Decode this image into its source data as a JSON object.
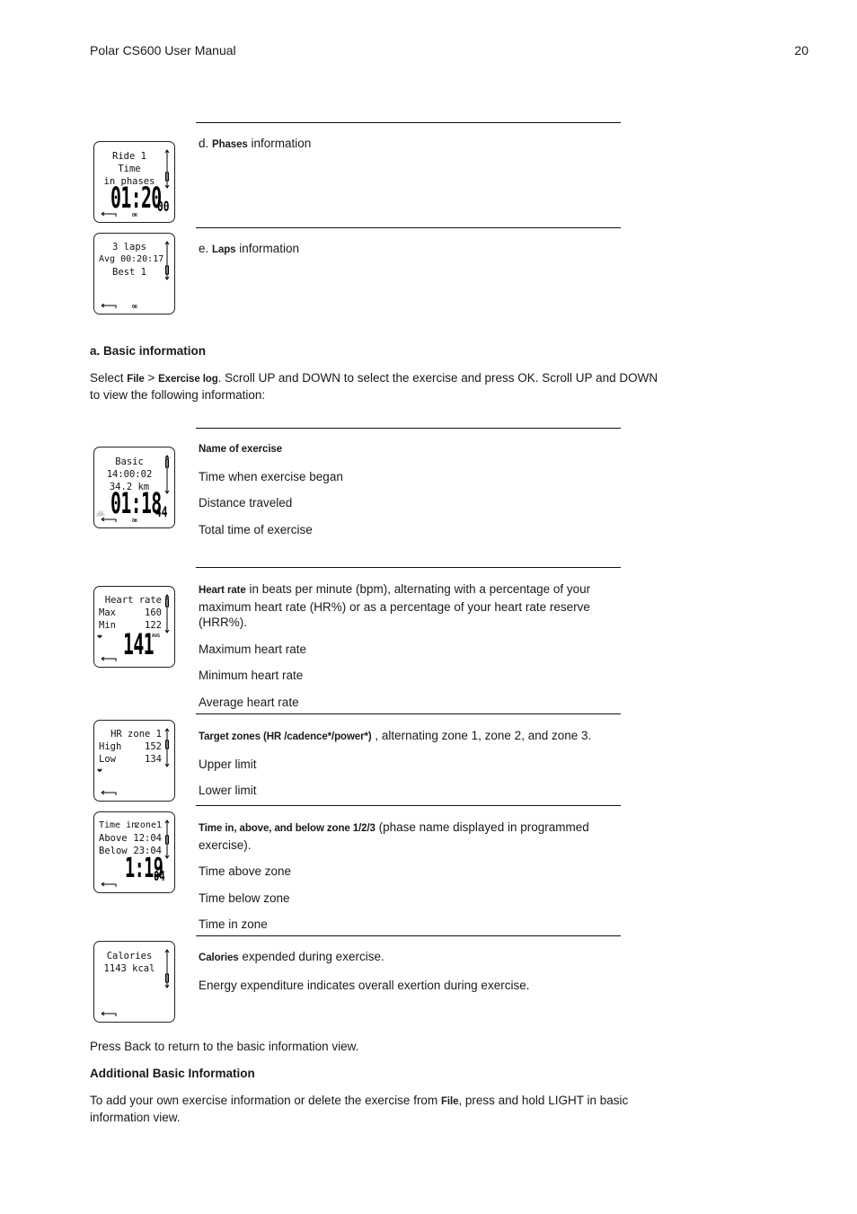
{
  "header": {
    "title": "Polar CS600 User Manual",
    "page_number": "20"
  },
  "sections": {
    "phases": {
      "prefix": "d. ",
      "bold": "Phases",
      "rest": " information"
    },
    "laps": {
      "prefix": "e. ",
      "bold": "Laps",
      "rest": " information"
    },
    "basic_heading": "a. Basic information",
    "basic_intro": {
      "t1": "Select ",
      "b1": "File",
      "t2": " > ",
      "b2": "Exercise log",
      "t3": ". Scroll UP and DOWN to select the exercise and press OK. Scroll UP and DOWN to view the following information:"
    },
    "basic_items": {
      "name": "Name of exercise",
      "items": [
        "Time when exercise began",
        "Distance traveled",
        "Total time of exercise"
      ]
    },
    "heart_rate": {
      "bold": "Heart rate",
      "rest": " in beats per minute (bpm), alternating with a percentage of your maximum heart rate (HR%) or as a percentage of your heart rate reserve (HRR%).",
      "items": [
        "Maximum heart rate",
        "Minimum heart rate",
        "Average heart rate"
      ]
    },
    "target_zones": {
      "bold": "Target zones (HR /cadence*/power*)",
      "rest": " , alternating zone 1, zone 2, and zone 3.",
      "items": [
        "Upper limit",
        "Lower limit"
      ]
    },
    "time_in_zone": {
      "bold": "Time in, above, and below zone 1/2/3",
      "rest": " (phase name displayed in programmed exercise).",
      "items": [
        "Time above zone",
        "Time below zone",
        "Time in zone"
      ]
    },
    "calories": {
      "bold": "Calories",
      "rest": " expended during exercise.",
      "items": [
        "Energy expenditure indicates overall exertion during exercise."
      ]
    },
    "press_back": "Press Back to return to the basic information view.",
    "additional_heading": "Additional Basic Information",
    "additional": {
      "t1": "To add your own exercise information or delete the exercise from ",
      "b1": "File",
      "t2": ", press and hold LIGHT in basic information view."
    }
  },
  "watch_screens": {
    "phases": {
      "lines": [
        "Ride 1",
        "Time",
        "in phases"
      ],
      "big": "01:20",
      "small": "00",
      "ok": "OK"
    },
    "laps": {
      "lines": [
        "3 laps",
        "Avg 00:20:17",
        "Best 1"
      ],
      "ok": "OK"
    },
    "basic": {
      "lines": [
        "Basic",
        "14:00:02",
        "34.2 km"
      ],
      "big": "01:18",
      "small": "44",
      "ok": "OK"
    },
    "heart_rate": {
      "title": "Heart rate",
      "rows": [
        [
          "Max",
          "160"
        ],
        [
          "Min",
          "122"
        ]
      ],
      "big": "141",
      "tag": "AVG"
    },
    "hr_zone": {
      "title": "HR zone 1",
      "rows": [
        [
          "High",
          "152"
        ],
        [
          "Low",
          "134"
        ]
      ]
    },
    "time_in_zone": {
      "rows": [
        [
          "Time in",
          "zone1"
        ],
        [
          "Above",
          "12:04"
        ],
        [
          "Below",
          "23:04"
        ]
      ],
      "big": "1:19",
      "small": "04"
    },
    "calories": {
      "lines": [
        "Calories",
        "1143 kcal"
      ]
    }
  }
}
